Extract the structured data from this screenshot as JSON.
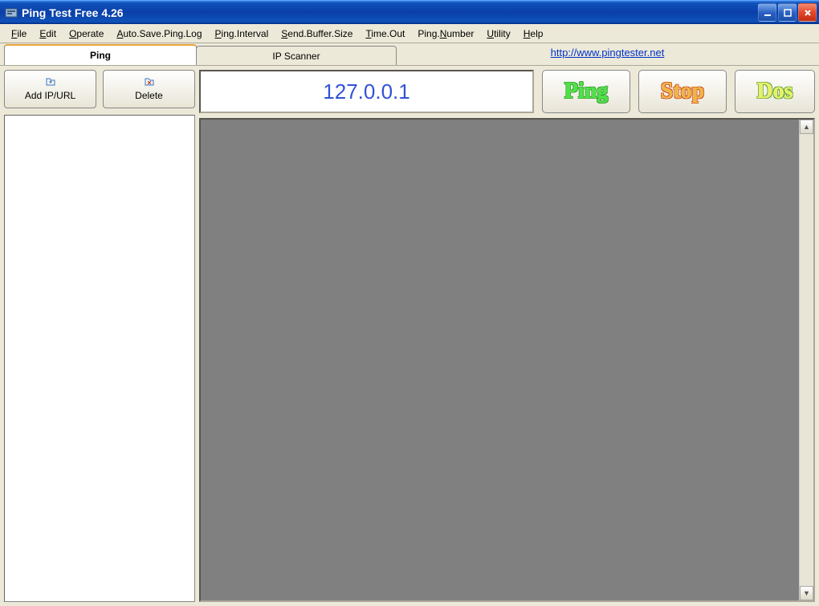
{
  "window": {
    "title": "Ping Test Free 4.26"
  },
  "menu": {
    "file": "File",
    "edit": "Edit",
    "operate": "Operate",
    "autosave": "Auto.Save.Ping.Log",
    "interval": "Ping.Interval",
    "buffer": "Send.Buffer.Size",
    "timeout": "Time.Out",
    "number": "Ping.Number",
    "utility": "Utility",
    "help": "Help"
  },
  "tabs": {
    "ping": "Ping",
    "ipscanner": "IP Scanner"
  },
  "link": {
    "url_text": "http://www.pingtester.net"
  },
  "sidebar": {
    "add_label": "Add IP/URL",
    "delete_label": "Delete"
  },
  "main": {
    "ip_value": "127.0.0.1",
    "ping_label": "Ping",
    "stop_label": "Stop",
    "dos_label": "Dos"
  }
}
